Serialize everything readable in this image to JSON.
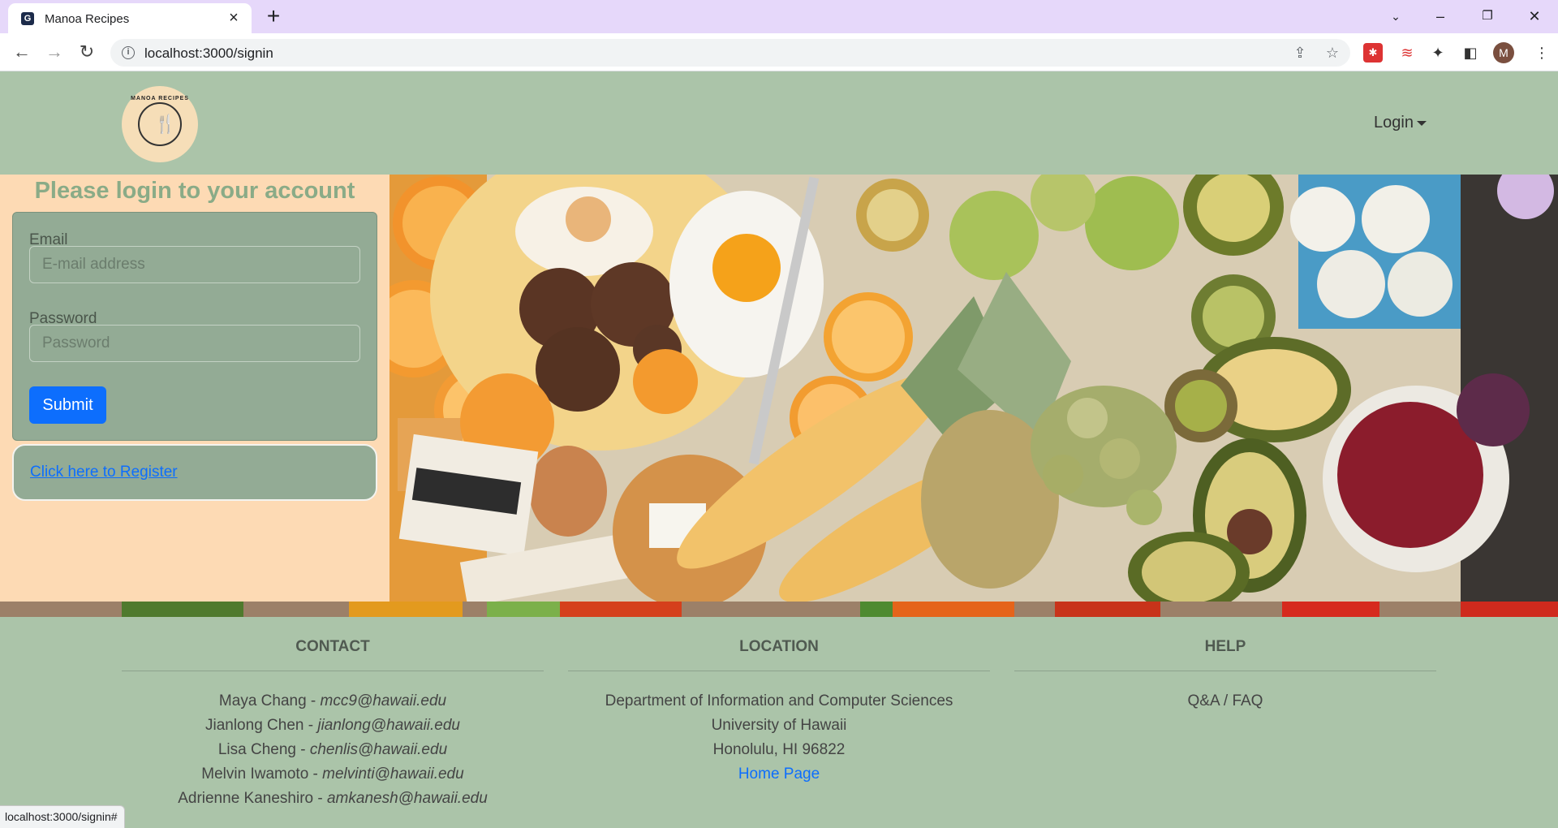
{
  "browser": {
    "tab_title": "Manoa Recipes",
    "url": "localhost:3000/signin",
    "avatar_letter": "M"
  },
  "navbar": {
    "logo_text": "MANOA RECIPES",
    "login_label": "Login"
  },
  "login": {
    "heading": "Please login to your account",
    "email_label": "Email",
    "email_placeholder": "E-mail address",
    "password_label": "Password",
    "password_placeholder": "Password",
    "submit_label": "Submit",
    "register_link": "Click here to Register"
  },
  "footer": {
    "contact": {
      "heading": "CONTACT",
      "people": [
        {
          "name": "Maya Chang - ",
          "email": "mcc9@hawaii.edu"
        },
        {
          "name": "Jianlong Chen - ",
          "email": "jianlong@hawaii.edu"
        },
        {
          "name": "Lisa Cheng - ",
          "email": "chenlis@hawaii.edu"
        },
        {
          "name": "Melvin Iwamoto - ",
          "email": "melvinti@hawaii.edu"
        },
        {
          "name": "Adrienne Kaneshiro - ",
          "email": "amkanesh@hawaii.edu"
        }
      ]
    },
    "location": {
      "heading": "LOCATION",
      "lines": [
        "Department of Information and Computer Sciences",
        "University of Hawaii",
        "Honolulu, HI 96822"
      ],
      "home_link": "Home Page"
    },
    "help": {
      "heading": "HELP",
      "faq": "Q&A / FAQ"
    }
  },
  "status_bar": "localhost:3000/signin#",
  "colors": {
    "page_green": "#abc4a9",
    "left_panel": "#fddab4",
    "card": "#93ab95",
    "heading_green": "#8aab87",
    "primary_blue": "#0d6efd"
  }
}
